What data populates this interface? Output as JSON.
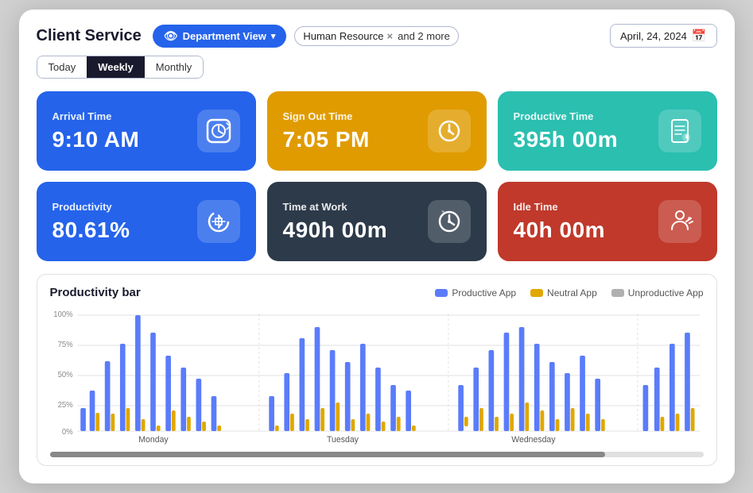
{
  "header": {
    "title": "Client Service",
    "dept_view_label": "Department View",
    "filter_tag": "Human Resource",
    "filter_more": "and 2 more",
    "date_label": "April, 24, 2024",
    "today_label": "Today",
    "weekly_label": "Weekly",
    "monthly_label": "Monthly",
    "active_range": "Weekly"
  },
  "cards": [
    {
      "id": "arrival",
      "label": "Arrival Time",
      "value": "9:10 AM",
      "color": "card-arrival",
      "icon": "⏱"
    },
    {
      "id": "signout",
      "label": "Sign Out  Time",
      "value": "7:05 PM",
      "color": "card-signout",
      "icon": "🕐"
    },
    {
      "id": "productive",
      "label": "Productive Time",
      "value": "395h 00m",
      "color": "card-productive",
      "icon": "⏳"
    },
    {
      "id": "productivity-pct",
      "label": "Productivity",
      "value": "80.61%",
      "color": "card-productivity-pct",
      "icon": "🔄"
    },
    {
      "id": "time-at-work",
      "label": "Time at Work",
      "value": "490h 00m",
      "color": "card-time-at-work",
      "icon": "🕐"
    },
    {
      "id": "idle",
      "label": "Idle Time",
      "value": "40h 00m",
      "color": "card-idle",
      "icon": "👤"
    }
  ],
  "chart": {
    "title": "Productivity bar",
    "legend": [
      {
        "label": "Productive App",
        "color": "legend-productive"
      },
      {
        "label": "Neutral App",
        "color": "legend-neutral"
      },
      {
        "label": "Unproductive App",
        "color": "legend-unproductive"
      }
    ],
    "days": [
      "Monday",
      "Tuesday",
      "Wednesday"
    ],
    "y_labels": [
      "100%",
      "75%",
      "50%",
      "25%",
      "0%"
    ],
    "bars": {
      "monday": {
        "productive": [
          20,
          35,
          60,
          75,
          100,
          85,
          65,
          55,
          45,
          30
        ],
        "neutral": [
          0,
          10,
          15,
          20,
          10,
          5,
          18,
          12,
          8,
          5
        ],
        "unproductive": [
          0,
          0,
          5,
          5,
          0,
          0,
          0,
          5,
          3,
          0
        ]
      },
      "tuesday": {
        "productive": [
          30,
          50,
          80,
          90,
          70,
          60,
          75,
          55,
          40,
          35
        ],
        "neutral": [
          5,
          15,
          10,
          20,
          25,
          10,
          15,
          8,
          12,
          5
        ],
        "unproductive": [
          0,
          5,
          0,
          0,
          5,
          0,
          0,
          3,
          0,
          0
        ]
      },
      "wednesday": {
        "productive": [
          40,
          55,
          70,
          85,
          90,
          75,
          60,
          50,
          65,
          45
        ],
        "neutral": [
          8,
          20,
          12,
          15,
          25,
          18,
          10,
          20,
          15,
          10
        ],
        "unproductive": [
          0,
          0,
          5,
          5,
          5,
          0,
          0,
          3,
          0,
          5
        ]
      }
    }
  }
}
